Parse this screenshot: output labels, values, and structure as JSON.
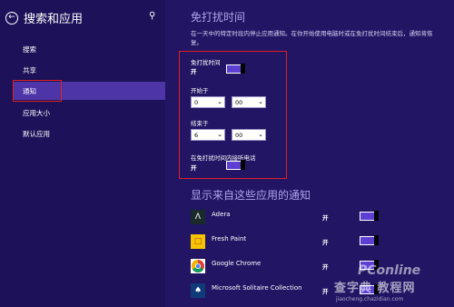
{
  "left_pane": {
    "back_icon": "back-arrow-icon",
    "title": "搜索和应用",
    "search_icon": "search-icon",
    "nav_items": [
      {
        "label": "搜索"
      },
      {
        "label": "共享"
      },
      {
        "label": "通知"
      },
      {
        "label": "应用大小"
      },
      {
        "label": "默认应用"
      }
    ],
    "active_index": 2
  },
  "quiet_hours": {
    "title": "免打扰时间",
    "description": "在一天中的特定时段内停止应用通知。在你开始使用电脑时或在免打扰时间结束后，通知将恢复。",
    "toggle_label": "免打扰时间",
    "toggle_state": "开",
    "start_label": "开始于",
    "start_hour": "0",
    "start_minute": "00",
    "end_label": "结束于",
    "end_hour": "6",
    "end_minute": "00",
    "calls_label": "在免打扰时间内接听电话",
    "calls_state": "开"
  },
  "apps_section": {
    "title": "显示来自这些应用的通知",
    "apps": [
      {
        "name": "Adera",
        "state": "开",
        "icon": "adera-icon",
        "icon_bg": "#1a2a2a"
      },
      {
        "name": "Fresh Paint",
        "state": "开",
        "icon": "fresh-paint-icon",
        "icon_bg": "#f5c400"
      },
      {
        "name": "Google Chrome",
        "state": "开",
        "icon": "chrome-icon",
        "icon_bg": "#ffffff"
      },
      {
        "name": "Microsoft Solitaire Collection",
        "state": "开",
        "icon": "solitaire-icon",
        "icon_bg": "#0f3b7a"
      }
    ]
  },
  "watermark": {
    "logo": "PConline",
    "cn_text": "查字典 教程网",
    "url": "jiaocheng.chazidian.com"
  },
  "colors": {
    "left_bg": "#1d1259",
    "right_bg": "#221564",
    "accent": "#5d3fd3",
    "nav_active": "#4d35a8",
    "highlight": "#e02020"
  }
}
